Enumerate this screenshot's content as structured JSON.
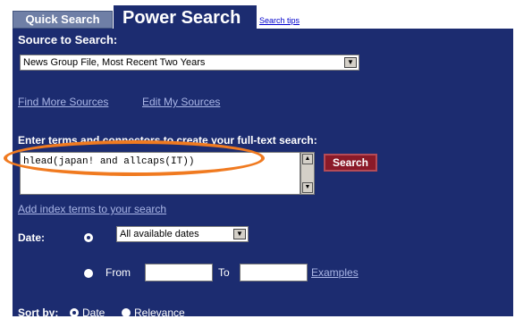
{
  "tabs": {
    "quick_search": "Quick Search",
    "power_search": "Power Search",
    "search_tips": "Search tips"
  },
  "source": {
    "heading": "Source to Search:",
    "selected": "News Group File, Most Recent Two Years",
    "find_more": "Find More Sources",
    "edit_my": "Edit My Sources"
  },
  "query": {
    "heading": "Enter terms and connectors to create your full-text search:",
    "value": "hlead(japan! and allcaps(IT))",
    "search_button": "Search",
    "add_index": "Add index terms to your search"
  },
  "date": {
    "label": "Date:",
    "selected": "All available dates",
    "from_label": "From",
    "to_label": "To",
    "from_value": "",
    "to_value": "",
    "examples": "Examples"
  },
  "sort": {
    "label": "Sort by:",
    "date_option": "Date",
    "relevance_option": "Relevance"
  },
  "colors": {
    "panel": "#1c2c70",
    "highlight": "#f07a20",
    "search_button": "#8b1a28"
  },
  "icons": {
    "dropdown": "chevron-down-icon",
    "scroll_up": "arrow-up-icon",
    "scroll_down": "arrow-down-icon"
  }
}
